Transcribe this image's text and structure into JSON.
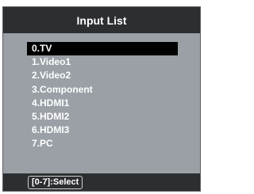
{
  "menu": {
    "title": "Input List",
    "selected_index": 0,
    "items": [
      {
        "label": "0.TV"
      },
      {
        "label": "1.Video1"
      },
      {
        "label": "2.Video2"
      },
      {
        "label": "3.Component"
      },
      {
        "label": "4.HDMI1"
      },
      {
        "label": "5.HDMI2"
      },
      {
        "label": "6.HDMI3"
      },
      {
        "label": "7.PC"
      }
    ],
    "hint": "[0-7]:Select"
  },
  "colors": {
    "panel": "#9aa0a6",
    "header": "#2d2e31",
    "selected": "#000000",
    "text": "#ffffff"
  }
}
